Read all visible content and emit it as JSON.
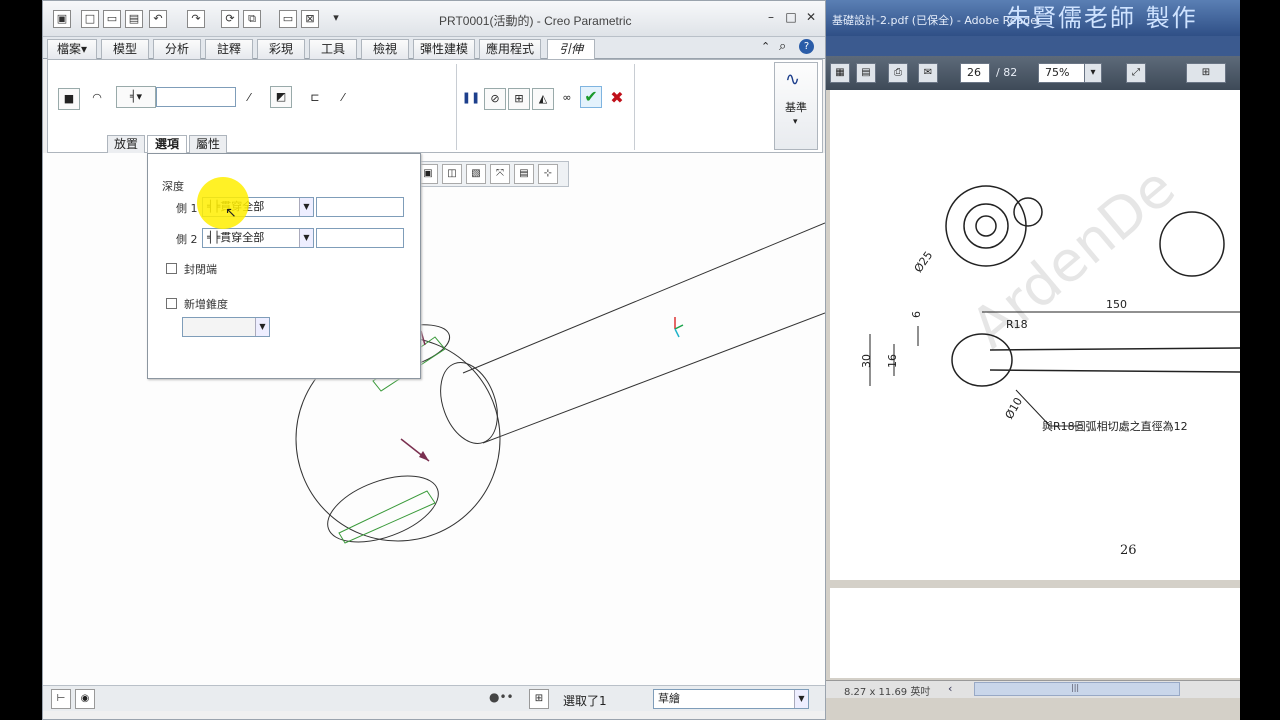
{
  "creo": {
    "title": "PRT0001(活動的) - Creo Parametric",
    "tabs": [
      "檔案",
      "模型",
      "分析",
      "註釋",
      "彩現",
      "工具",
      "檢視",
      "彈性建模",
      "應用程式",
      "引伸"
    ],
    "file_tab_arrow": "▾",
    "ribbon": {
      "depth_value": "",
      "datum_label": "基準"
    },
    "subtabs": [
      "放置",
      "選項",
      "屬性"
    ],
    "options_panel": {
      "depth_label": "深度",
      "side1_label": "側 1",
      "side1_value": "貫穿全部",
      "side2_label": "側 2",
      "side2_value": "貫穿全部",
      "capped_ends_label": "封閉端",
      "add_taper_label": "新增錐度"
    },
    "status": {
      "selected_text": "選取了1",
      "filter_value": "草繪"
    }
  },
  "reader": {
    "title": "基礎設計-2.pdf (已保全) - Adobe Reader",
    "overlay_text": "朱賢儒老師 製作",
    "page_number": "26",
    "page_total": "/ 82",
    "zoom": "75%",
    "page_label": "26",
    "page_size": "8.27 x 11.69 英吋",
    "drawing": {
      "dim_150": "150",
      "dim_r18": "R18",
      "dim_phi25": "Ø25",
      "dim_30": "30",
      "dim_16": "16",
      "dim_6": "6",
      "dim_phi10": "Ø10",
      "note": "與R18圓弧相切處之直徑為12",
      "watermark": "ArdenDe"
    }
  },
  "colors": {
    "check_green": "#1a9a2a",
    "cancel_red": "#c0101a",
    "highlight": "#ffee00",
    "reader_blue": "#2f4f86"
  }
}
